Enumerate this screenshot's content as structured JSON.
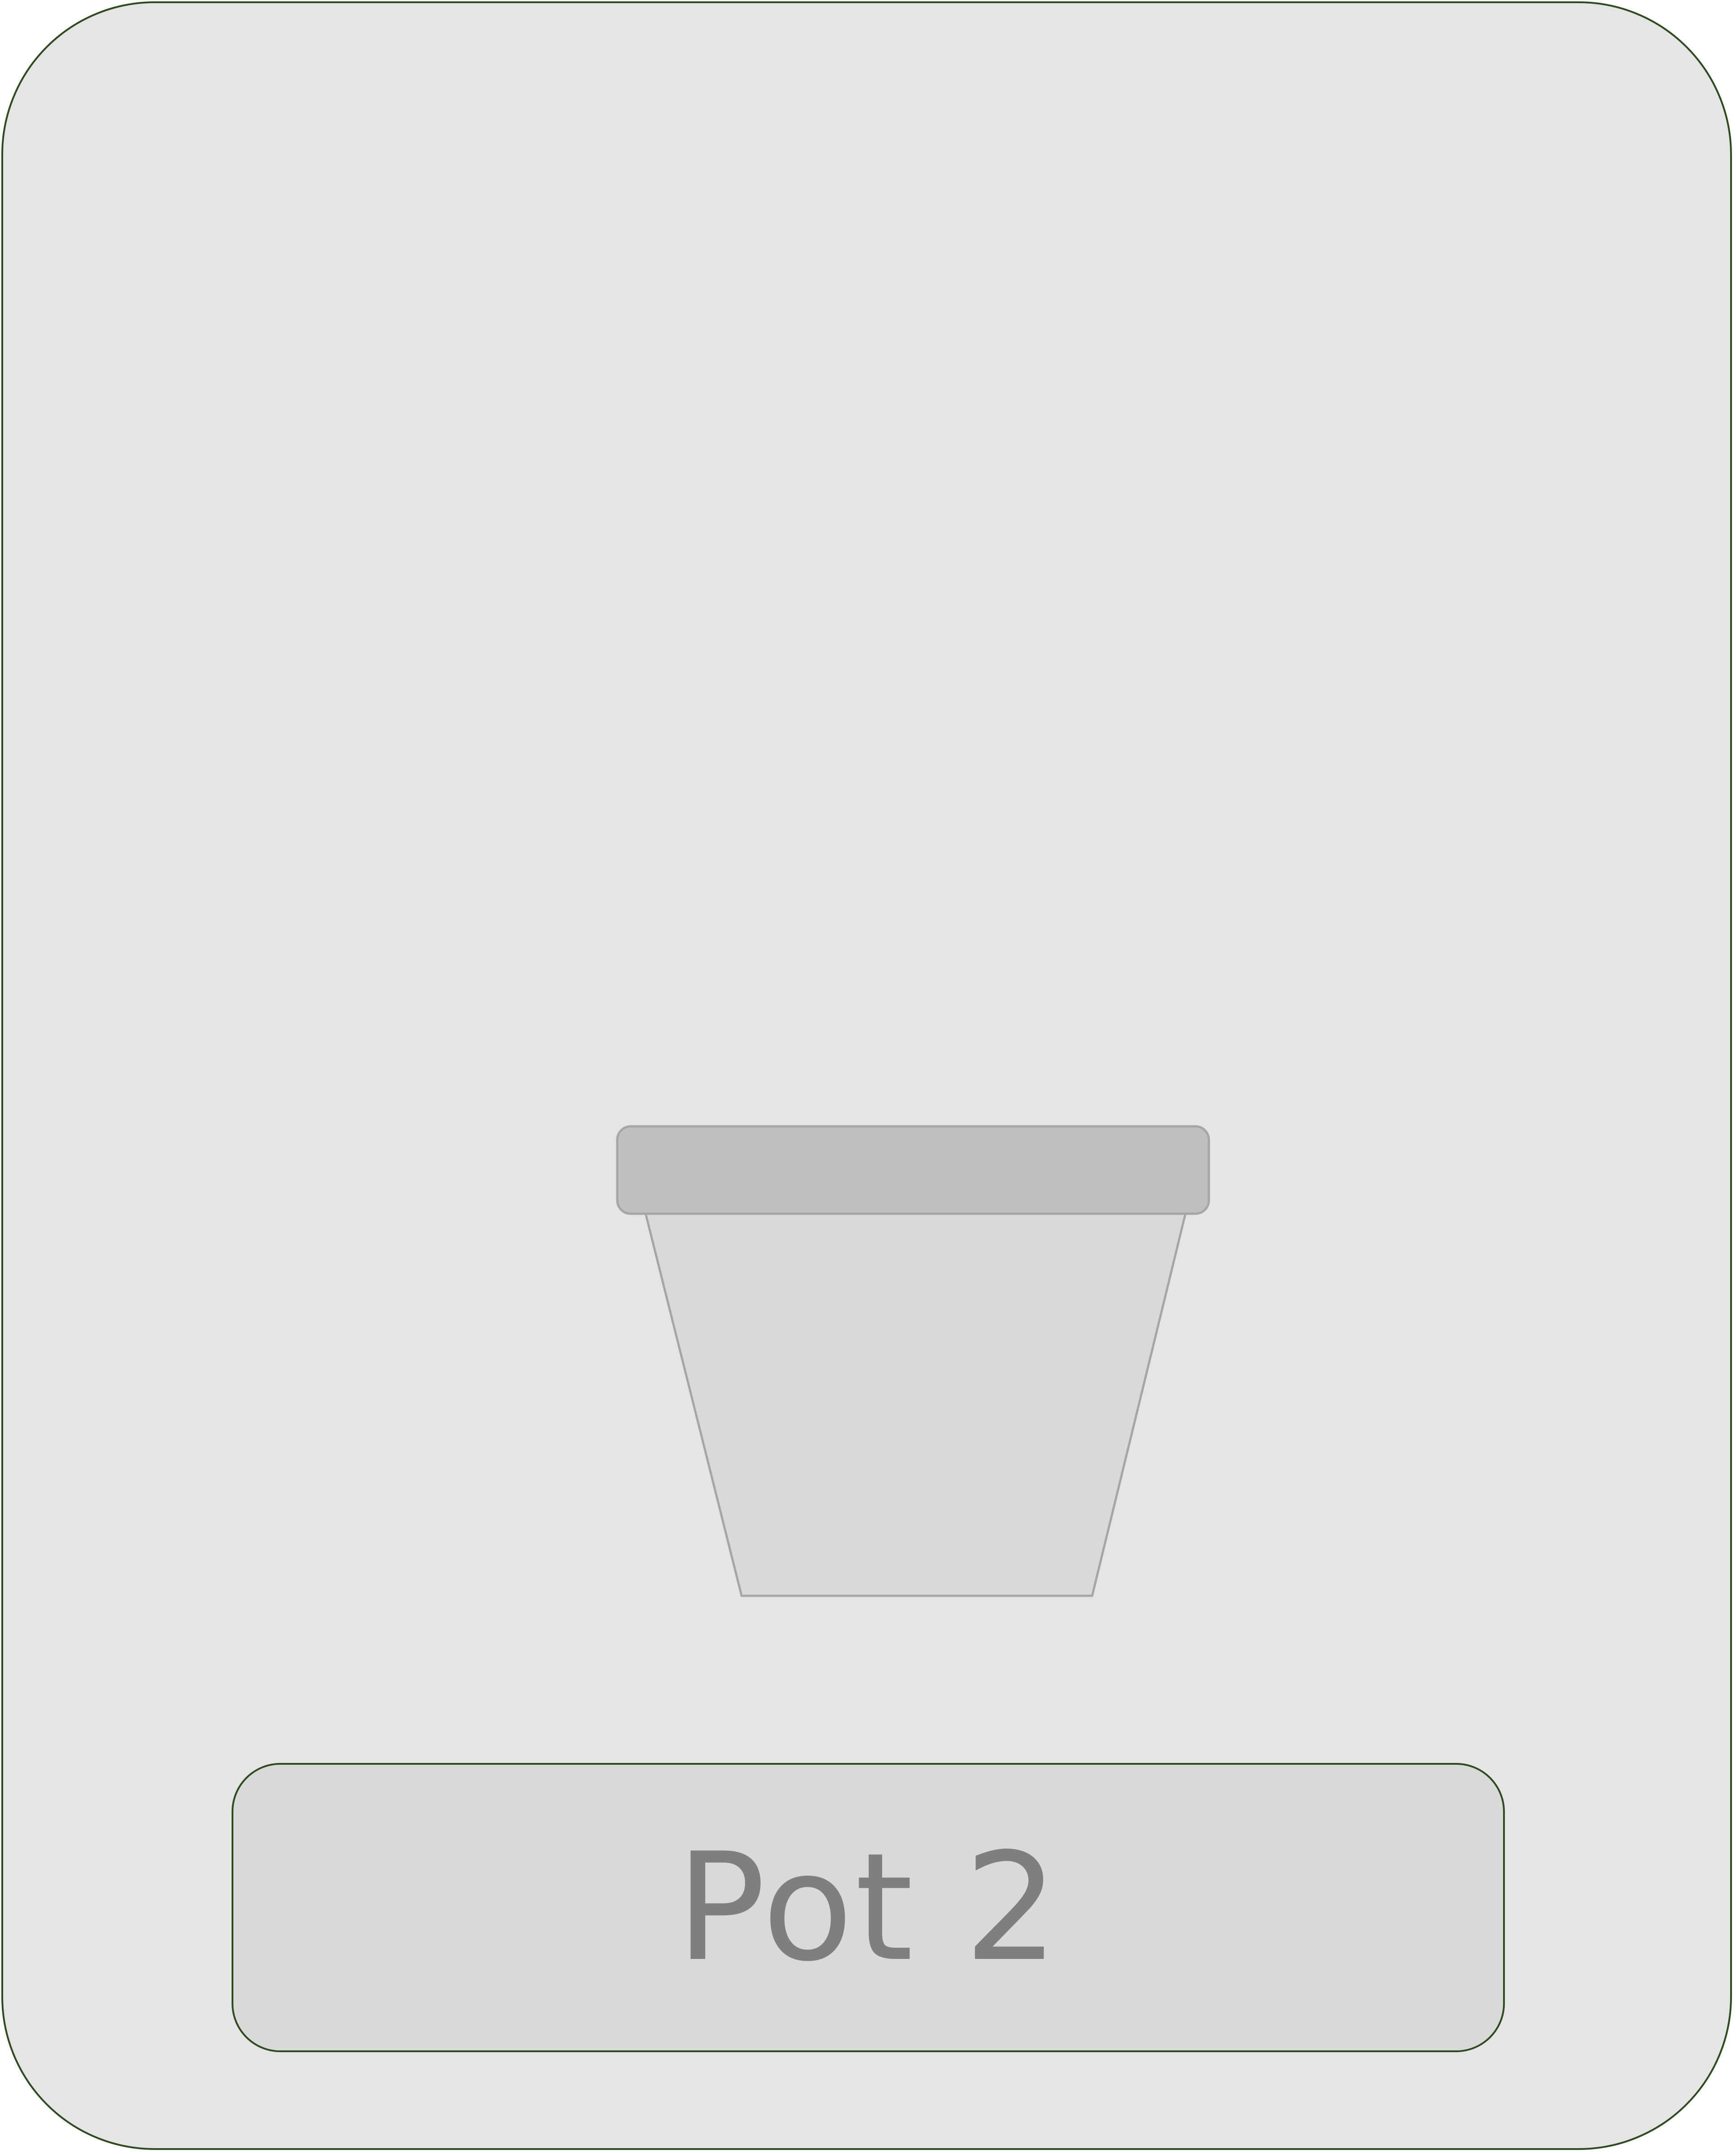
{
  "card": {
    "background_color": "#e5e5e5",
    "border_color": "#2f4a1e"
  },
  "pot": {
    "icon": "flower-pot-icon",
    "rim_color": "#bfbfbf",
    "body_color": "#d9d9d9",
    "outline_color": "#a6a6a6"
  },
  "label": {
    "text": "Pot 2",
    "background_color": "#d9d9d9",
    "text_color": "#7f7f7f"
  }
}
